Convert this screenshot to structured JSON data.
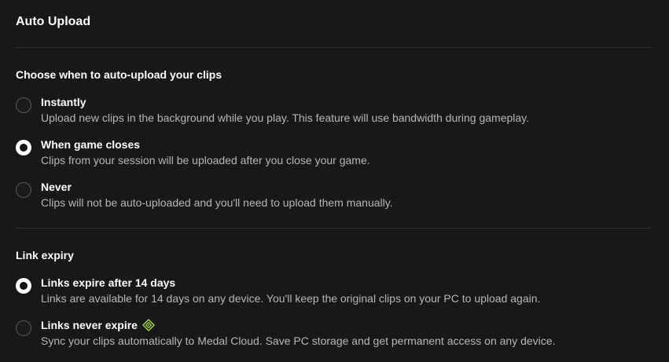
{
  "page": {
    "title": "Auto Upload"
  },
  "auto_upload": {
    "section_title": "Choose when to auto-upload your clips",
    "selected": "when_game_closes",
    "options": [
      {
        "id": "instantly",
        "label": "Instantly",
        "description": "Upload new clips in the background while you play. This feature will use bandwidth during gameplay."
      },
      {
        "id": "when_game_closes",
        "label": "When game closes",
        "description": "Clips from your session will be uploaded after you close your game."
      },
      {
        "id": "never",
        "label": "Never",
        "description": "Clips will not be auto-uploaded and you'll need to upload them manually."
      }
    ]
  },
  "link_expiry": {
    "section_title": "Link expiry",
    "selected": "expire_14_days",
    "options": [
      {
        "id": "expire_14_days",
        "label": "Links expire after 14 days",
        "description": "Links are available for 14 days on any device. You'll keep the original clips on your PC to upload again."
      },
      {
        "id": "never_expire",
        "label": "Links never expire",
        "description": "Sync your clips automatically to Medal Cloud. Save PC storage and get permanent access on any device.",
        "badge_icon": "premium-diamond-icon"
      }
    ]
  },
  "colors": {
    "background": "#181818",
    "divider": "#2f2f2f",
    "text_primary": "#ffffff",
    "text_secondary": "#b8b8b8",
    "premium_accent": "#a6e22e"
  }
}
